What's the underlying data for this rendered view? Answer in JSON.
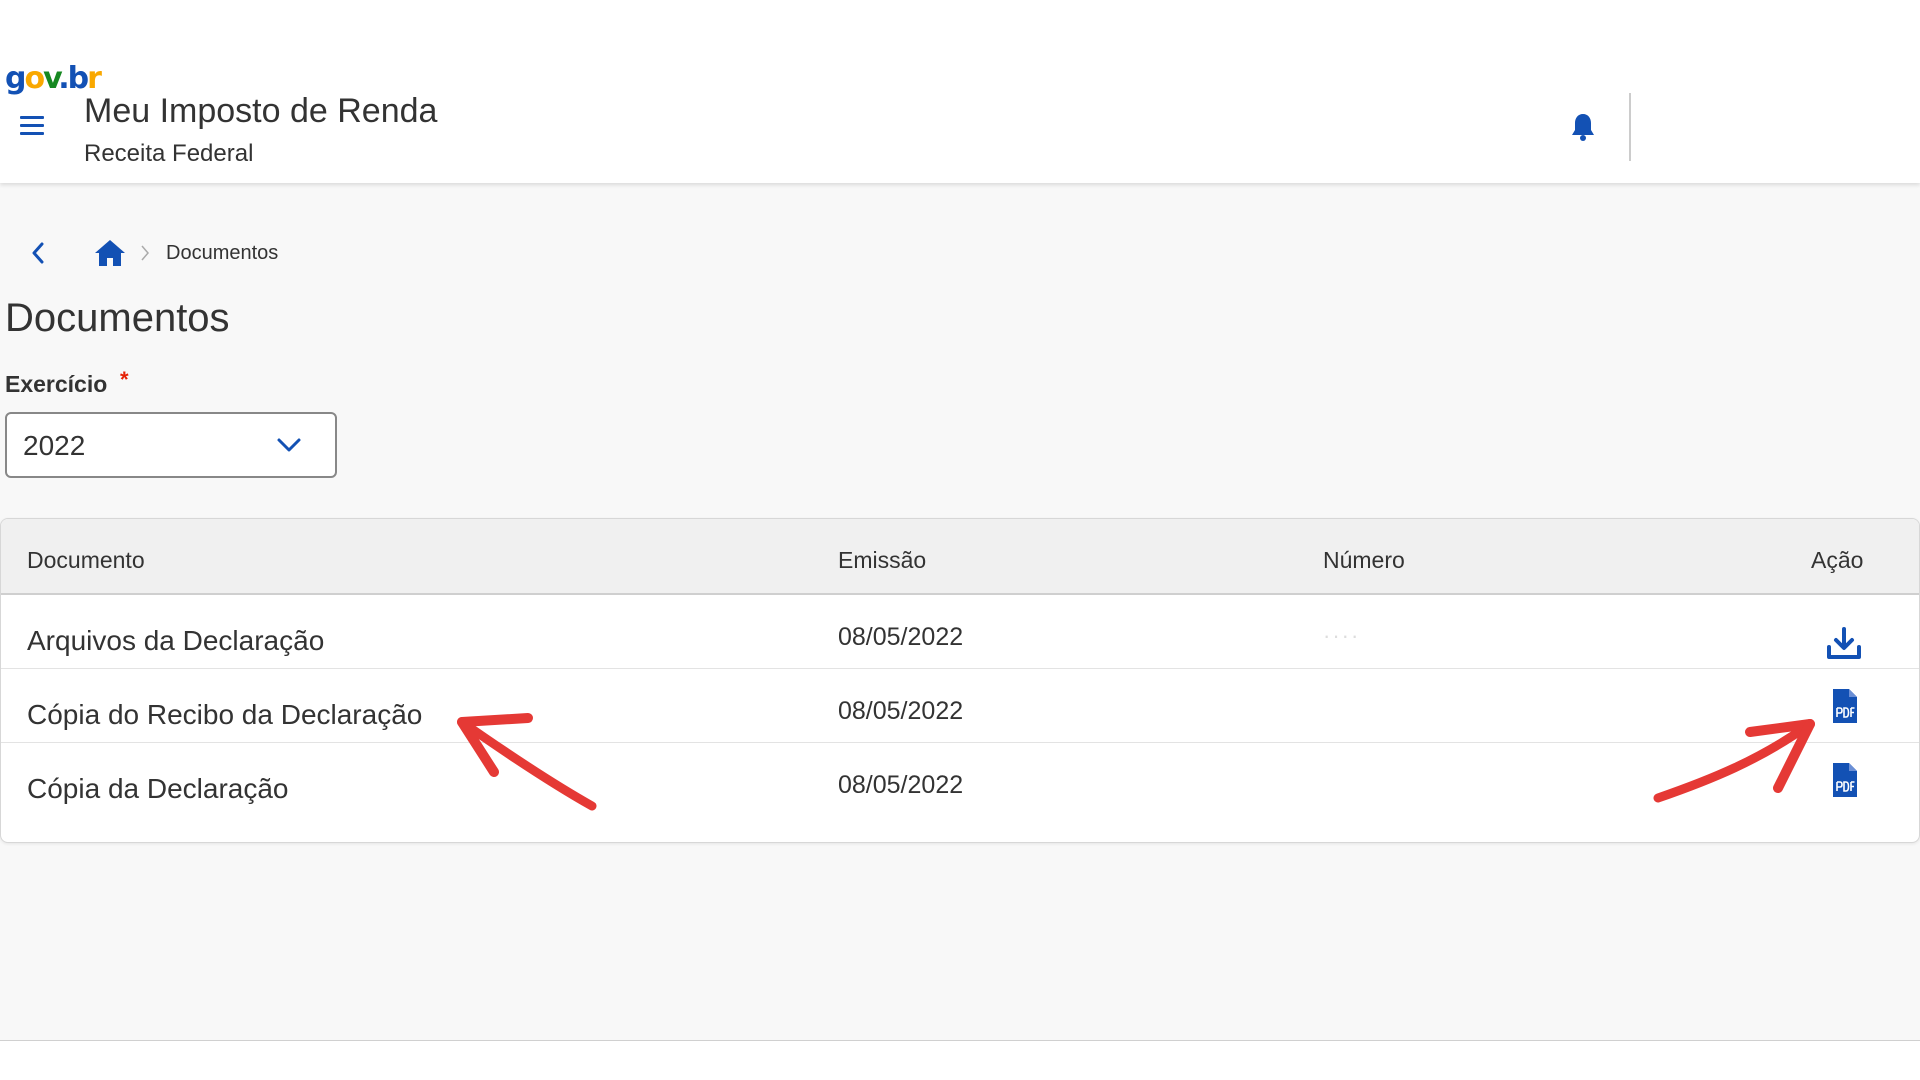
{
  "header": {
    "logo": {
      "g": "g",
      "o": "o",
      "v": "v",
      "dot": ".",
      "b": "b",
      "r": "r"
    },
    "title": "Meu Imposto de Renda",
    "subtitle": "Receita Federal"
  },
  "breadcrumb": {
    "current": "Documentos"
  },
  "page": {
    "title": "Documentos"
  },
  "filter": {
    "label": "Exercício",
    "required_mark": "*",
    "selected": "2022"
  },
  "table": {
    "columns": [
      "Documento",
      "Emissão",
      "Número",
      "Ação"
    ],
    "rows": [
      {
        "documento": "Arquivos da Declaração",
        "emissao": "08/05/2022",
        "action_icon": "download-icon"
      },
      {
        "documento": "Cópia do Recibo da Declaração",
        "emissao": "08/05/2022",
        "action_icon": "pdf-icon"
      },
      {
        "documento": "Cópia da Declaração",
        "emissao": "08/05/2022",
        "action_icon": "pdf-icon"
      }
    ]
  },
  "icons": {
    "menu": "hamburger-menu-icon",
    "bell": "bell-icon",
    "back": "chevron-left-icon",
    "home": "home-icon",
    "separator": "chevron-right-icon",
    "select": "chevron-down-icon"
  },
  "colors": {
    "primary": "#1351b4",
    "required": "#e52207",
    "annotation": "#e53935",
    "text": "#333333",
    "background": "#f8f8f8"
  }
}
